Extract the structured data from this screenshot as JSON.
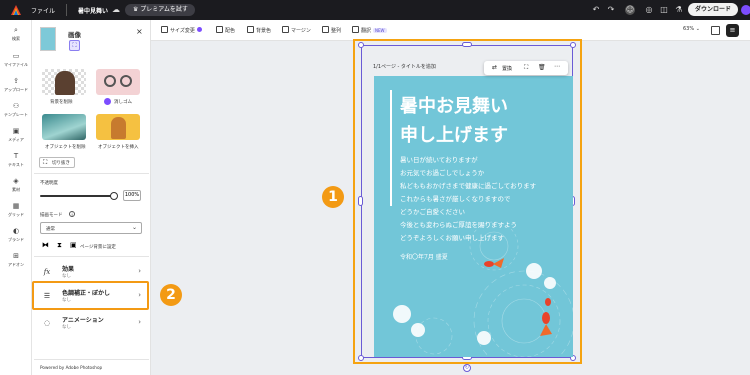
{
  "topbar": {
    "file_menu": "ファイル",
    "doc_title": "暑中見舞い",
    "premium_label": "プレミアムを試す",
    "download_label": "ダウンロード"
  },
  "rail": {
    "items": [
      "検索",
      "マイファイル",
      "アップロード",
      "テンプレート",
      "メディア",
      "テキスト",
      "素材",
      "グリッド",
      "ブランド",
      "アドオン"
    ]
  },
  "panel": {
    "title": "画像",
    "actions": [
      "背景を削除",
      "消しゴム",
      "オブジェクトを削除",
      "オブジェクトを挿入"
    ],
    "crop_label": "切り抜き",
    "opacity_label": "不透明度",
    "opacity_value": "100%",
    "blend_label": "描画モード",
    "blend_value": "通常",
    "set_bg_label": "ページ背景に設定",
    "props": [
      {
        "title": "効果",
        "sub": "なし"
      },
      {
        "title": "色調補正・ぼかし",
        "sub": "なし"
      },
      {
        "title": "アニメーション",
        "sub": "なし"
      }
    ],
    "footer": "Powered by Adobe Photoshop"
  },
  "toolbar": {
    "items": [
      "サイズ変更",
      "配色",
      "背景色",
      "マージン",
      "整列",
      "翻訳"
    ],
    "new_badge": "NEW",
    "zoom": "63%"
  },
  "canvas": {
    "page_label": "1/1ページ - タイトルを追加",
    "ctx": {
      "replace_label": "置換"
    },
    "card": {
      "title_lines": [
        "暑中お見舞い",
        "申し上げます"
      ],
      "body_lines": [
        "暑い日が続いておりますが",
        "お元気でお過ごしでしょうか",
        "私どももおかげさまで健康に過ごしております",
        "これからも暑さが厳しくなりますので",
        "どうかご自愛ください",
        "今後とも変わらぬご厚誼を賜りますよう",
        "どうぞよろしくお願い申し上げます"
      ],
      "date": "令和〇年7月 盛夏"
    }
  },
  "badges": [
    "1",
    "2"
  ],
  "colors": {
    "accent": "#f39a14",
    "card_bg": "#72c6d8",
    "topbar_bg": "#1b1b1f",
    "selection": "#6a5bd6"
  }
}
